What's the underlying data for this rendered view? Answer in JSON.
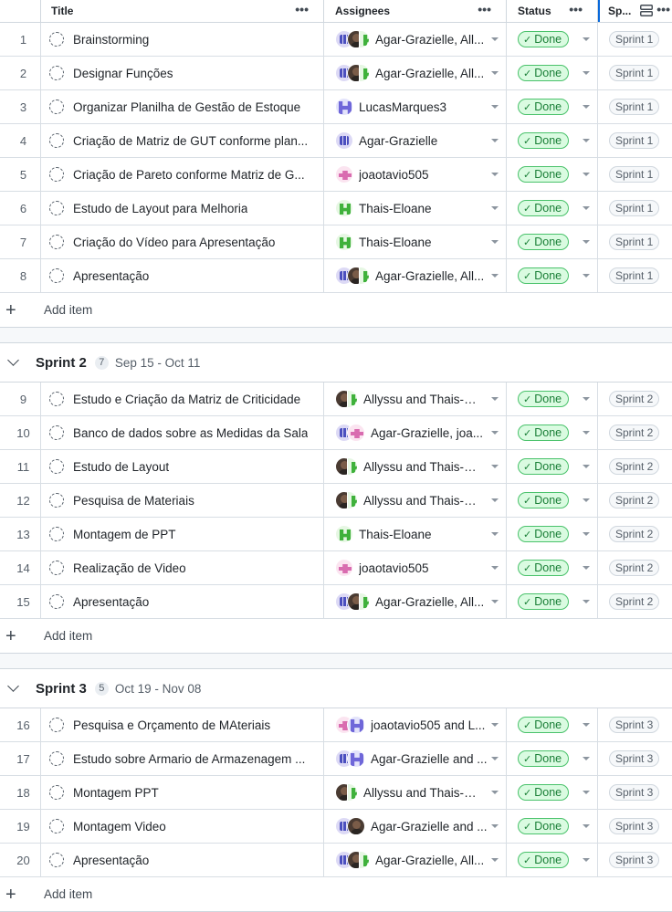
{
  "columns": {
    "title": "Title",
    "assignees": "Assignees",
    "status": "Status",
    "sprint": "Sp..."
  },
  "add_item_label": "Add item",
  "groups": [
    {
      "name": null,
      "items": [
        {
          "num": "1",
          "title": "Brainstorming",
          "assignees": "Agar-Grazielle, All...",
          "avatars": [
            "agar",
            "allyssu",
            "thais-small"
          ],
          "status": "Done",
          "sprint": "Sprint 1"
        },
        {
          "num": "2",
          "title": "Designar Funções",
          "assignees": "Agar-Grazielle, All...",
          "avatars": [
            "agar",
            "allyssu",
            "thais-small"
          ],
          "status": "Done",
          "sprint": "Sprint 1"
        },
        {
          "num": "3",
          "title": "Organizar Planilha de Gestão de Estoque",
          "assignees": "LucasMarques3",
          "avatars": [
            "lucas"
          ],
          "status": "Done",
          "sprint": "Sprint 1"
        },
        {
          "num": "4",
          "title": "Criação de Matriz de GUT conforme plan...",
          "assignees": "Agar-Grazielle",
          "avatars": [
            "agar"
          ],
          "status": "Done",
          "sprint": "Sprint 1"
        },
        {
          "num": "5",
          "title": "Criação de Pareto conforme Matriz de G...",
          "assignees": "joaotavio505",
          "avatars": [
            "joao"
          ],
          "status": "Done",
          "sprint": "Sprint 1"
        },
        {
          "num": "6",
          "title": "Estudo de Layout para Melhoria",
          "assignees": "Thais-Eloane",
          "avatars": [
            "thais"
          ],
          "status": "Done",
          "sprint": "Sprint 1"
        },
        {
          "num": "7",
          "title": "Criação do Vídeo para Apresentação",
          "assignees": "Thais-Eloane",
          "avatars": [
            "thais"
          ],
          "status": "Done",
          "sprint": "Sprint 1"
        },
        {
          "num": "8",
          "title": "Apresentação",
          "assignees": "Agar-Grazielle, All...",
          "avatars": [
            "agar",
            "allyssu",
            "thais-small"
          ],
          "status": "Done",
          "sprint": "Sprint 1"
        }
      ]
    },
    {
      "name": "Sprint 2",
      "count": "7",
      "dates": "Sep 15 - Oct 11",
      "items": [
        {
          "num": "9",
          "title": "Estudo e Criação da Matriz de Criticidade",
          "assignees": "Allyssu and Thais-El...",
          "avatars": [
            "allyssu",
            "thais-small"
          ],
          "status": "Done",
          "sprint": "Sprint 2"
        },
        {
          "num": "10",
          "title": "Banco de dados sobre as Medidas da Sala",
          "assignees": "Agar-Grazielle, joa...",
          "avatars": [
            "agar",
            "joao"
          ],
          "status": "Done",
          "sprint": "Sprint 2"
        },
        {
          "num": "11",
          "title": "Estudo de Layout",
          "assignees": "Allyssu and Thais-El...",
          "avatars": [
            "allyssu",
            "thais-small"
          ],
          "status": "Done",
          "sprint": "Sprint 2"
        },
        {
          "num": "12",
          "title": "Pesquisa de Materiais",
          "assignees": "Allyssu and Thais-El...",
          "avatars": [
            "allyssu",
            "thais-small"
          ],
          "status": "Done",
          "sprint": "Sprint 2"
        },
        {
          "num": "13",
          "title": "Montagem de PPT",
          "assignees": "Thais-Eloane",
          "avatars": [
            "thais"
          ],
          "status": "Done",
          "sprint": "Sprint 2"
        },
        {
          "num": "14",
          "title": "Realização de Video",
          "assignees": "joaotavio505",
          "avatars": [
            "joao"
          ],
          "status": "Done",
          "sprint": "Sprint 2"
        },
        {
          "num": "15",
          "title": "Apresentação",
          "assignees": "Agar-Grazielle, All...",
          "avatars": [
            "agar",
            "allyssu",
            "thais-small"
          ],
          "status": "Done",
          "sprint": "Sprint 2"
        }
      ]
    },
    {
      "name": "Sprint 3",
      "count": "5",
      "dates": "Oct 19 - Nov 08",
      "items": [
        {
          "num": "16",
          "title": "Pesquisa e Orçamento de MAteriais",
          "assignees": "joaotavio505 and L...",
          "avatars": [
            "joao",
            "lucas"
          ],
          "status": "Done",
          "sprint": "Sprint 3"
        },
        {
          "num": "17",
          "title": "Estudo sobre Armario de Armazenagem ...",
          "assignees": "Agar-Grazielle and ...",
          "avatars": [
            "agar",
            "lucas"
          ],
          "status": "Done",
          "sprint": "Sprint 3"
        },
        {
          "num": "18",
          "title": "Montagem PPT",
          "assignees": "Allyssu and Thais-El...",
          "avatars": [
            "allyssu",
            "thais-small"
          ],
          "status": "Done",
          "sprint": "Sprint 3"
        },
        {
          "num": "19",
          "title": "Montagem Video",
          "assignees": "Agar-Grazielle and ...",
          "avatars": [
            "agar",
            "allyssu"
          ],
          "status": "Done",
          "sprint": "Sprint 3"
        },
        {
          "num": "20",
          "title": "Apresentação",
          "assignees": "Agar-Grazielle, All...",
          "avatars": [
            "agar",
            "allyssu",
            "thais-small"
          ],
          "status": "Done",
          "sprint": "Sprint 3"
        }
      ]
    }
  ],
  "colors": {
    "done_green": "#1a7f37",
    "done_bg": "#dafbe1",
    "border": "#d0d7de",
    "accent": "#0969da"
  },
  "icons": {
    "column_menu": "kebab-horizontal-icon",
    "status": "check-icon",
    "item": "dashed-circle-draft-icon",
    "add": "plus-icon",
    "group_toggle": "chevron-down-icon",
    "layout": "view-split-icon"
  }
}
